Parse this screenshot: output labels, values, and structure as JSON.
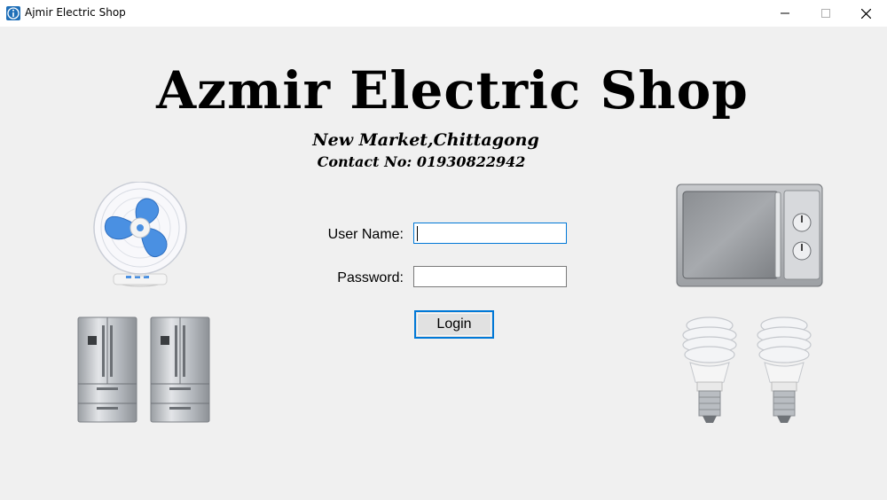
{
  "window": {
    "title": "Ajmir Electric Shop",
    "icon": "info-icon",
    "controls": [
      "minimize-icon",
      "maximize-icon",
      "close-icon"
    ]
  },
  "header": {
    "shop_name": "Azmir Electric Shop",
    "address": "New Market,Chittagong",
    "contact": "Contact No: 01930822942"
  },
  "login_form": {
    "username_label": "User Name:",
    "username_value": "",
    "password_label": "Password:",
    "password_value": "",
    "login_label": "Login"
  },
  "images": [
    "table-fan",
    "refrigerator",
    "refrigerator",
    "microwave-oven",
    "light-bulb",
    "light-bulb"
  ],
  "colors": {
    "accent": "#0078d7",
    "background": "#f0f0f0",
    "titlebar": "#ffffff",
    "fan_blade": "#4a90e2"
  }
}
